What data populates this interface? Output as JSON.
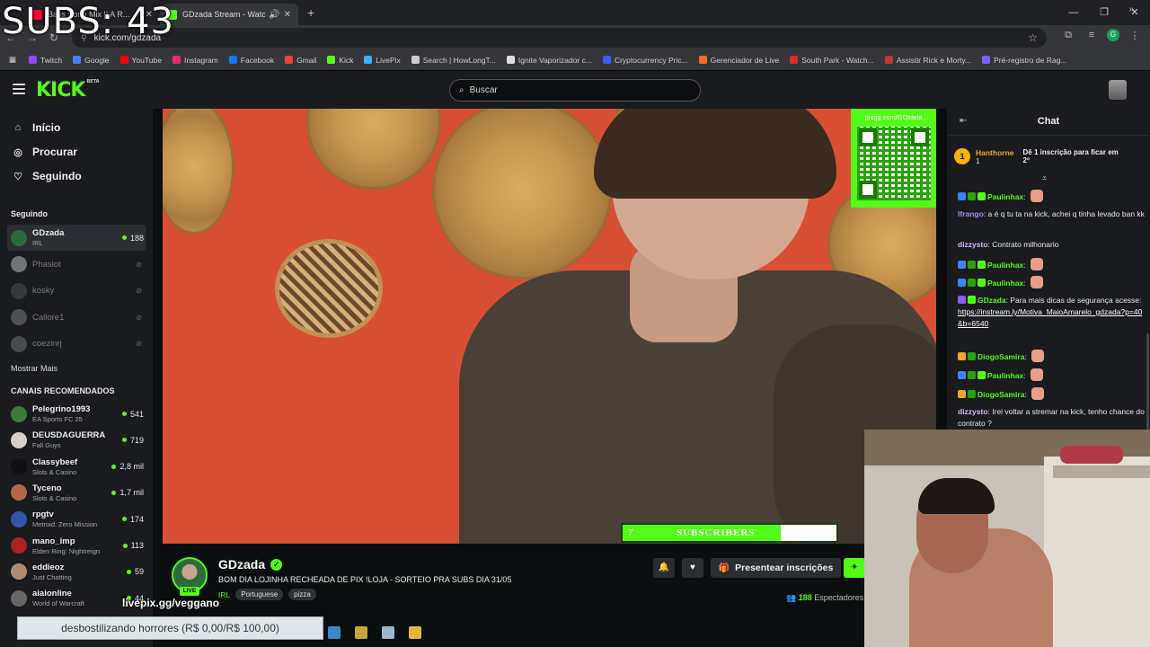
{
  "overlay": {
    "subs_count_text": "SUBS: 43"
  },
  "browser": {
    "tabs": [
      {
        "title": "Bass Song Mix || A R...",
        "favicon_color": "#ff0033",
        "active": false
      },
      {
        "title": "GDzada Stream - Watch Live",
        "favicon_color": "#53fc18",
        "active": true
      }
    ],
    "new_tab": "+",
    "url": "kick.com/gdzada",
    "bookmarks": [
      {
        "label": "Twitch",
        "color": "#9146ff"
      },
      {
        "label": "Google",
        "color": "#4285f4"
      },
      {
        "label": "YouTube",
        "color": "#ff0000"
      },
      {
        "label": "Instagram",
        "color": "#e1306c"
      },
      {
        "label": "Facebook",
        "color": "#1877f2"
      },
      {
        "label": "Gmail",
        "color": "#ea4335"
      },
      {
        "label": "Kick",
        "color": "#53fc18"
      },
      {
        "label": "LivePix",
        "color": "#3ab0ff"
      },
      {
        "label": "Search | HowLongT...",
        "color": "#cccccc"
      },
      {
        "label": "Ignite Vaporizador c...",
        "color": "#dddddd"
      },
      {
        "label": "Cryptocurrency Pric...",
        "color": "#3861fb"
      },
      {
        "label": "Gerenciador de Live",
        "color": "#f36c21"
      },
      {
        "label": "South Park - Watch...",
        "color": "#d73027"
      },
      {
        "label": "Assistir Rick e Morty...",
        "color": "#c0392b"
      },
      {
        "label": "Pré-registro de Rag...",
        "color": "#7b61ff"
      }
    ]
  },
  "header": {
    "logo": "KICK",
    "logo_tag": "BETA",
    "search_placeholder": "Buscar"
  },
  "sidebar": {
    "nav": [
      {
        "label": "Início",
        "icon": "home-icon"
      },
      {
        "label": "Procurar",
        "icon": "compass-icon"
      },
      {
        "label": "Seguindo",
        "icon": "heart-icon"
      }
    ],
    "following_title": "Seguindo",
    "following": [
      {
        "name": "GDzada",
        "category": "IRL",
        "viewers": "188",
        "live": true,
        "avatar_color": "#2d6b3c"
      },
      {
        "name": "Phasiot",
        "category": "",
        "viewers": "",
        "live": false,
        "avatar_color": "#cccccc"
      },
      {
        "name": "kosky",
        "category": "",
        "viewers": "",
        "live": false,
        "avatar_color": "#555555"
      },
      {
        "name": "Callore1",
        "category": "",
        "viewers": "",
        "live": false,
        "avatar_color": "#888888"
      },
      {
        "name": "coezinrj",
        "category": "",
        "viewers": "",
        "live": false,
        "avatar_color": "#777777"
      }
    ],
    "show_more": "Mostrar Mais",
    "recommended_title": "CANAIS RECOMENDADOS",
    "recommended": [
      {
        "name": "Pelegrino1993",
        "category": "EA Sports FC 25",
        "viewers": "541",
        "avatar_color": "#3a7a3a"
      },
      {
        "name": "DEUSDAGUERRA",
        "category": "Fall Guys",
        "viewers": "719",
        "avatar_color": "#d8d0c8"
      },
      {
        "name": "Classybeef",
        "category": "Slots & Casino",
        "viewers": "2,8 mil",
        "avatar_color": "#111111"
      },
      {
        "name": "Tyceno",
        "category": "Slots & Casino",
        "viewers": "1,7 mil",
        "avatar_color": "#b5654a"
      },
      {
        "name": "rpgtv",
        "category": "Metroid: Zero Mission",
        "viewers": "174",
        "avatar_color": "#3355aa"
      },
      {
        "name": "mano_imp",
        "category": "Elden Ring: Nightreign",
        "viewers": "113",
        "avatar_color": "#aa2222"
      },
      {
        "name": "eddieoz",
        "category": "Just Chatting",
        "viewers": "59",
        "avatar_color": "#b08a70"
      },
      {
        "name": "aiaionline",
        "category": "World of Warcraft",
        "viewers": "44",
        "avatar_color": "#666666"
      }
    ]
  },
  "video": {
    "qr_label": "pixgg.com/GDzada",
    "subs_goal_count": "7",
    "subs_goal_label": "SUBSCRIBERS",
    "subs_goal_fill": 0.74
  },
  "stream": {
    "streamer": "GDzada",
    "live_label": "LIVE",
    "title": "BOM DIA LOJINHA RECHEADA DE PIX !LOJA - SORTEIO PRA SUBS DIA 31/05",
    "category": "IRL",
    "tags": [
      "Portuguese",
      "pizza"
    ],
    "gift_label": "Presentear inscrições",
    "viewers": "188",
    "viewers_label": "Espectadores",
    "livepix_text": "livepix.gg/veggano",
    "donation_text": "desbostilizando horrores (R$ 0,00/R$ 100,00)"
  },
  "chat": {
    "title": "Chat",
    "pinned": {
      "user": "Hanthorne",
      "count": "1",
      "text": "Dê 1 inscrição para ficar em 2º"
    },
    "messages": [
      {
        "user": "Paulinhax",
        "color": "#53fc18",
        "text": "",
        "badges": [
          "#3b82f6",
          "#2aa10e",
          "#53fc18"
        ],
        "emote": true
      },
      {
        "user": "lfrango",
        "color": "#a78bfa",
        "text": "a é q tu ta na kick, achei q tinha levado ban kk",
        "badges": [],
        "emote": false
      },
      {
        "user": "dizzysto",
        "color": "#d8b4fe",
        "text": "Contrato milhonario",
        "badges": [],
        "emote": false
      },
      {
        "user": "Paulinhax",
        "color": "#53fc18",
        "text": "",
        "badges": [
          "#3b82f6",
          "#2aa10e",
          "#53fc18"
        ],
        "emote": true
      },
      {
        "user": "Paulinhax",
        "color": "#53fc18",
        "text": "",
        "badges": [
          "#3b82f6",
          "#2aa10e",
          "#53fc18"
        ],
        "emote": true
      },
      {
        "user": "GDzada",
        "color": "#53fc18",
        "text": "Para mais dicas de segurança acesse:",
        "link": "https://instream.ly/Motiva_MaioAmarelo_gdzada?p=40&b=6540",
        "badges": [
          "#8b5cf6",
          "#53fc18"
        ],
        "emote": false
      },
      {
        "user": "DiogoSamira",
        "color": "#53fc18",
        "text": "",
        "badges": [
          "#f2a52b",
          "#2aa10e"
        ],
        "emote": true
      },
      {
        "user": "Paulinhax",
        "color": "#53fc18",
        "text": "",
        "badges": [
          "#3b82f6",
          "#2aa10e",
          "#53fc18"
        ],
        "emote": true
      },
      {
        "user": "DiogoSamira",
        "color": "#53fc18",
        "text": "",
        "badges": [
          "#f2a52b",
          "#2aa10e"
        ],
        "emote": true
      },
      {
        "user": "dizzysto",
        "color": "#d8b4fe",
        "text": "Irei voltar a stremar na kick, tenho chance do contrato ?",
        "badges": [],
        "emote": false
      }
    ]
  }
}
